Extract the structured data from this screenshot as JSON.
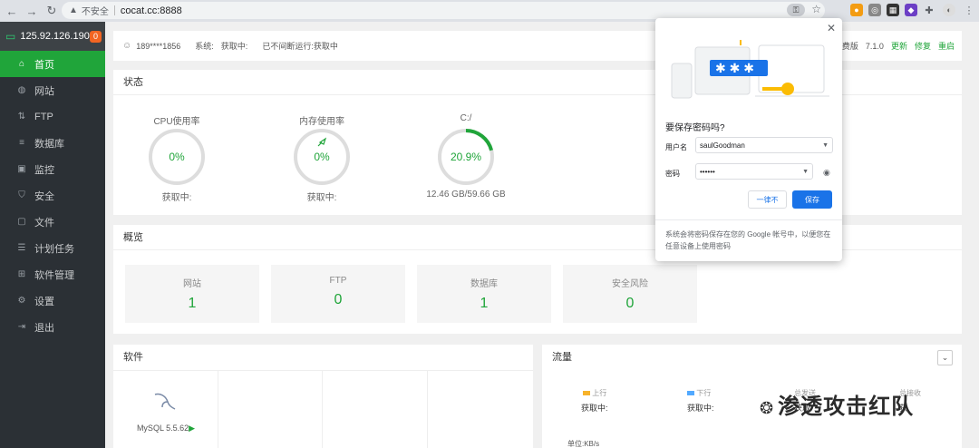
{
  "browser": {
    "security_label": "不安全",
    "url": "cocat.cc:8888"
  },
  "sidebar": {
    "server_ip": "125.92.126.190",
    "badge_count": "0",
    "items": [
      {
        "label": "首页",
        "icon": "home-icon"
      },
      {
        "label": "网站",
        "icon": "globe-icon"
      },
      {
        "label": "FTP",
        "icon": "ftp-icon"
      },
      {
        "label": "数据库",
        "icon": "database-icon"
      },
      {
        "label": "监控",
        "icon": "monitor-icon"
      },
      {
        "label": "安全",
        "icon": "shield-icon"
      },
      {
        "label": "文件",
        "icon": "folder-icon"
      },
      {
        "label": "计划任务",
        "icon": "task-icon"
      },
      {
        "label": "软件管理",
        "icon": "apps-icon"
      },
      {
        "label": "设置",
        "icon": "gear-icon"
      },
      {
        "label": "退出",
        "icon": "logout-icon"
      }
    ]
  },
  "topbar": {
    "user": "189****1856",
    "system_label": "系统:",
    "system_value": "获取中:",
    "uptime_label": "已不间断运行:",
    "uptime_value": "获取中",
    "edition": "免费版",
    "version": "7.1.0",
    "update": "更新",
    "repair": "修复",
    "restart": "重启"
  },
  "status": {
    "title": "状态",
    "gauges": [
      {
        "label": "CPU使用率",
        "value": "0%",
        "sub": "获取中:",
        "pct": 0
      },
      {
        "label": "内存使用率",
        "value": "0%",
        "sub": "获取中:",
        "pct": 0
      },
      {
        "label": "C:/",
        "value": "20.9%",
        "sub": "12.46 GB/59.66 GB",
        "pct": 20.9
      }
    ]
  },
  "overview": {
    "title": "概览",
    "cards": [
      {
        "label": "网站",
        "value": "1"
      },
      {
        "label": "FTP",
        "value": "0"
      },
      {
        "label": "数据库",
        "value": "1"
      },
      {
        "label": "安全风险",
        "value": "0"
      }
    ]
  },
  "software": {
    "title": "软件",
    "item": "MySQL 5.5.62"
  },
  "traffic": {
    "title": "流量",
    "up_label": "上行",
    "up_value": "获取中:",
    "down_label": "下行",
    "down_value": "获取中:",
    "total_send": "总发送",
    "total_recv": "总接收",
    "total_send_value": "获取",
    "total_recv_value": "获",
    "unit": "单位:KB/s",
    "up_color": "#f7b32b",
    "down_color": "#52a9ff"
  },
  "dialog": {
    "title": "要保存密码吗?",
    "username_label": "用户名",
    "username_value": "saulGoodman",
    "password_label": "密码",
    "password_value": "••••••",
    "never_button": "一律不",
    "save_button": "保存",
    "footer": "系统会将密码保存在您的 Google 帐号中，以便您在任意设备上使用密码"
  },
  "watermark": "渗透攻击红队",
  "colors": {
    "accent": "#20a53a",
    "sidebar_bg": "#2b3035",
    "badge": "#f26522",
    "chrome_blue": "#1a73e8"
  }
}
